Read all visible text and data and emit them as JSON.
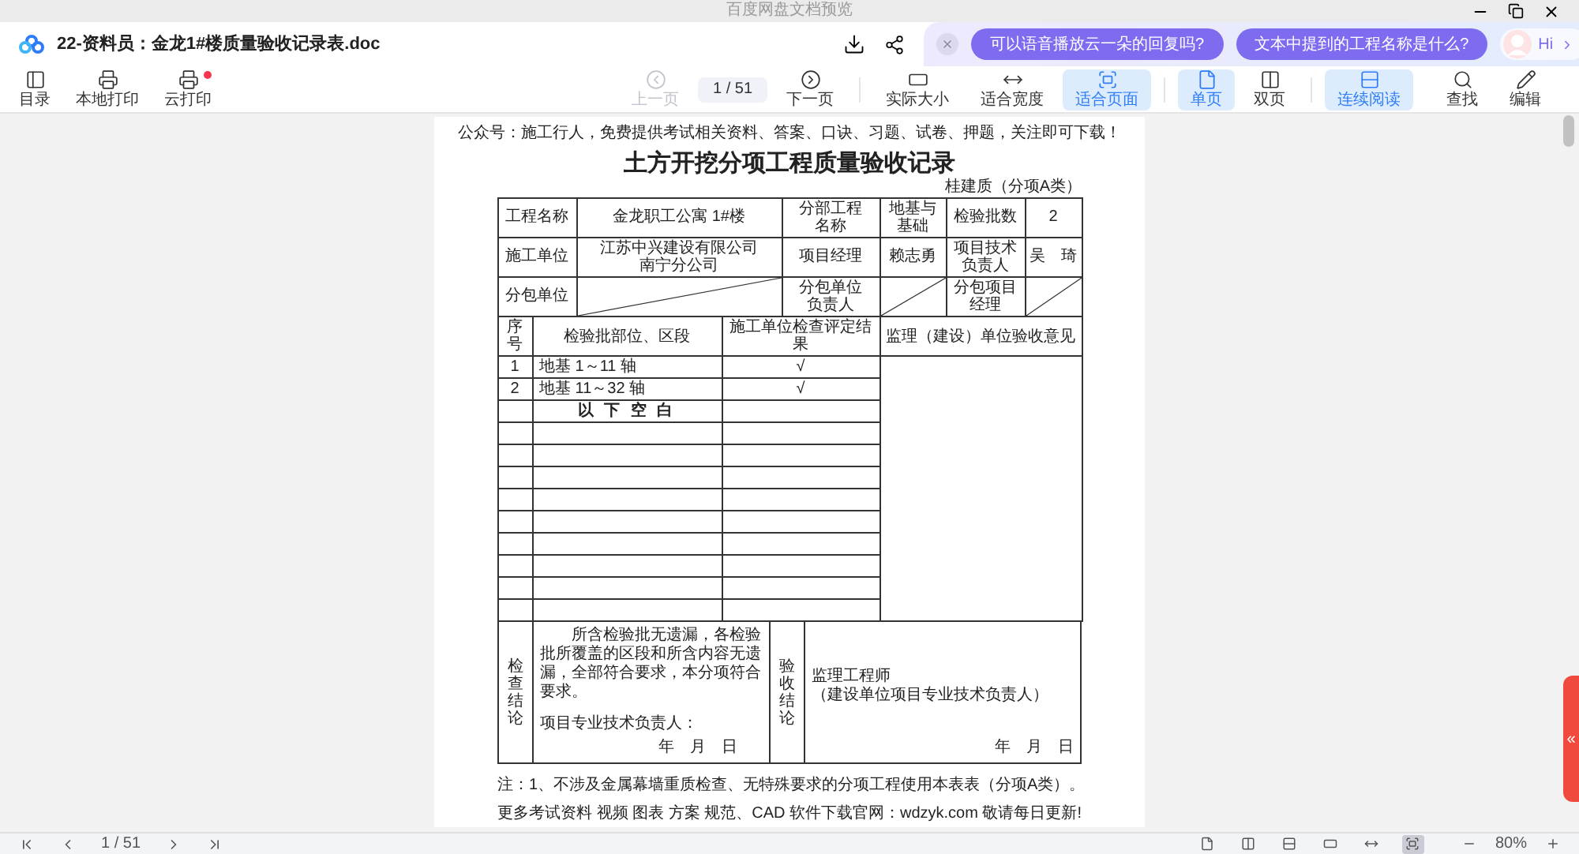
{
  "window": {
    "title": "百度网盘文档预览"
  },
  "header": {
    "filename": "22-资料员：金龙1#楼质量验收记录表.doc"
  },
  "assistant": {
    "suggestions": [
      "可以语音播放云一朵的回复吗?",
      "文本中提到的工程名称是什么?"
    ],
    "greeting": "Hi"
  },
  "toolbar": {
    "left": [
      {
        "label": "目录",
        "badge": false
      },
      {
        "label": "本地打印",
        "badge": false
      },
      {
        "label": "云打印",
        "badge": true
      }
    ],
    "prev": {
      "label": "上一页",
      "disabled": true
    },
    "page": "1 / 51",
    "next": {
      "label": "下一页",
      "disabled": false
    },
    "view": [
      {
        "label": "实际大小",
        "selected": false
      },
      {
        "label": "适合宽度",
        "selected": false
      },
      {
        "label": "适合页面",
        "selected": true
      },
      {
        "label": "单页",
        "selected": true
      },
      {
        "label": "双页",
        "selected": false
      },
      {
        "label": "连续阅读",
        "selected": true
      }
    ],
    "right": [
      {
        "label": "查找"
      },
      {
        "label": "编辑"
      }
    ]
  },
  "document": {
    "header_note": "公众号：施工行人，免费提供考试相关资料、答案、口诀、习题、试卷、押题，关注即可下载！",
    "title": "土方开挖分项工程质量验收记录",
    "form_code": "桂建质（分项A类）",
    "info_rows": [
      [
        {
          "kind": "label",
          "text": "工程名称"
        },
        {
          "kind": "value",
          "text": "金龙职工公寓 1#楼"
        },
        {
          "kind": "label",
          "text": "分部工程名称"
        },
        {
          "kind": "value",
          "text": "地基与基础"
        },
        {
          "kind": "label",
          "text": "检验批数"
        },
        {
          "kind": "value",
          "text": "2"
        }
      ],
      [
        {
          "kind": "label",
          "text": "施工单位"
        },
        {
          "kind": "value",
          "text": "江苏中兴建设有限公司南宁分公司"
        },
        {
          "kind": "label",
          "text": "项目经理"
        },
        {
          "kind": "value",
          "text": "赖志勇"
        },
        {
          "kind": "label",
          "text": "项目技术负责人"
        },
        {
          "kind": "value",
          "text": "吴　琦"
        }
      ],
      [
        {
          "kind": "label",
          "text": "分包单位"
        },
        {
          "kind": "slash"
        },
        {
          "kind": "label",
          "text": "分包单位负责人"
        },
        {
          "kind": "slash"
        },
        {
          "kind": "label",
          "text": "分包项目经理"
        },
        {
          "kind": "slash"
        }
      ]
    ],
    "item_headers": [
      "序号",
      "检验批部位、区段",
      "施工单位检查评定结果",
      "监理（建设）单位验收意见"
    ],
    "items": [
      {
        "kind": "entry",
        "no": "1",
        "part": "地基 1～11 轴",
        "result": "√"
      },
      {
        "kind": "entry",
        "no": "2",
        "part": "地基 11～32 轴",
        "result": "√"
      },
      {
        "kind": "remark",
        "part": "以 下 空 白"
      }
    ],
    "check_label": "检查结论",
    "check_text": "所含检验批无遗漏，各检验批所覆盖的区段和所含内容无遗漏，全部符合要求，本分项符合要求。",
    "check_signer": "项目专业技术负责人：",
    "check_date": "年　月　日",
    "accept_label": "验收结论",
    "accept_title": "监理工程师",
    "accept_sub": "（建设单位项目专业技术负责人）",
    "accept_date": "年　月　日",
    "note": "注：1、不涉及金属幕墙重质检查、无特殊要求的分项工程使用本表表（分项A类）。",
    "footer": "更多考试资料 视频 图表 方案 规范、CAD 软件下载官网：wdzyk.com 敬请每日更新!"
  },
  "side_tab": "«",
  "bottom_bar": {
    "page": "1 / 51",
    "zoom": "80%",
    "view_buttons": [
      {
        "selected": false
      },
      {
        "selected": false
      },
      {
        "selected": false
      },
      {
        "selected": false
      },
      {
        "selected": false
      },
      {
        "selected": true
      }
    ]
  }
}
